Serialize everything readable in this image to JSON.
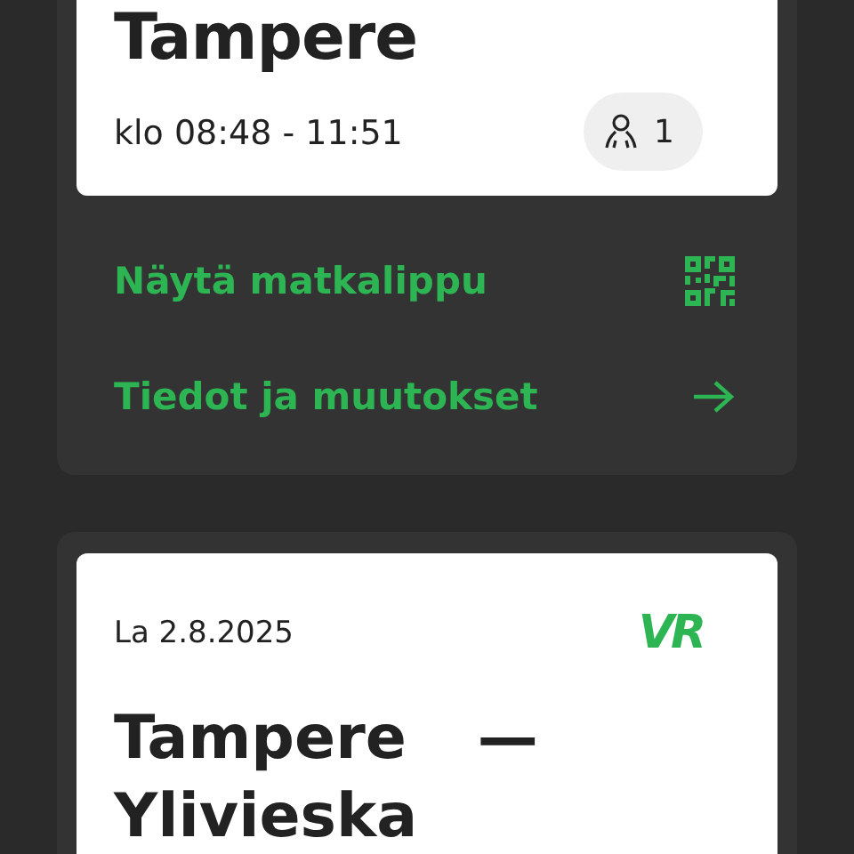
{
  "trips": [
    {
      "title": "Tampere",
      "time": "klo 08:48 - 11:51",
      "passengers": "1",
      "actions": [
        {
          "kind": "ticket",
          "label": "Näytä matkalippu"
        },
        {
          "kind": "details",
          "label": "Tiedot ja muutokset"
        }
      ]
    },
    {
      "date": "La 2.8.2025",
      "logo": "VR",
      "origin": "Tampere",
      "separator": "—",
      "destination": "Ylivieska"
    }
  ]
}
